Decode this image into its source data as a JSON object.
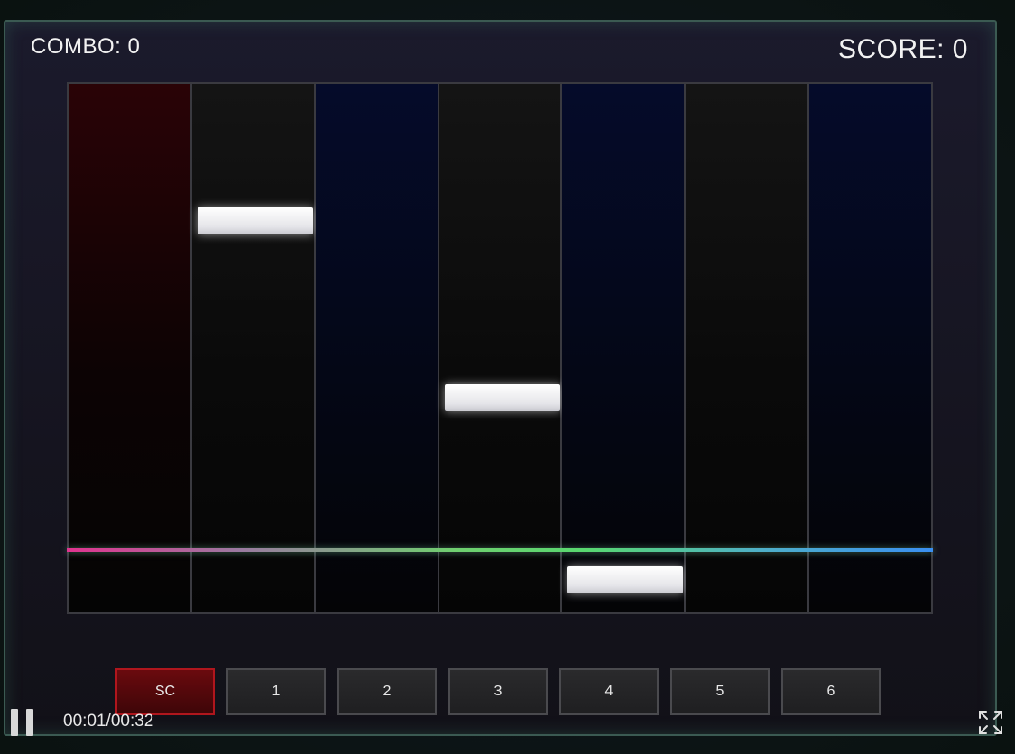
{
  "hud": {
    "combo_text": "COMBO: 0",
    "score_text": "SCORE: 0"
  },
  "playfield": {
    "lanes": [
      "red",
      "dark",
      "blue",
      "dark",
      "blue",
      "dark",
      "blue"
    ],
    "notes": [
      {
        "lane": 2
      },
      {
        "lane": 4
      },
      {
        "lane": 5
      }
    ],
    "hitline_colors": [
      "#e0348f",
      "#6fd06f",
      "#3a8ff0"
    ]
  },
  "keys": [
    {
      "label": "SC",
      "active": true
    },
    {
      "label": "1",
      "active": false
    },
    {
      "label": "2",
      "active": false
    },
    {
      "label": "3",
      "active": false
    },
    {
      "label": "4",
      "active": false
    },
    {
      "label": "5",
      "active": false
    },
    {
      "label": "6",
      "active": false
    }
  ],
  "player": {
    "time_text": "00:01/00:32",
    "pause_icon": "pause-icon",
    "fullscreen_icon": "fullscreen-icon"
  },
  "colors": {
    "active_key": "#b0161d",
    "note": "#ffffff"
  }
}
